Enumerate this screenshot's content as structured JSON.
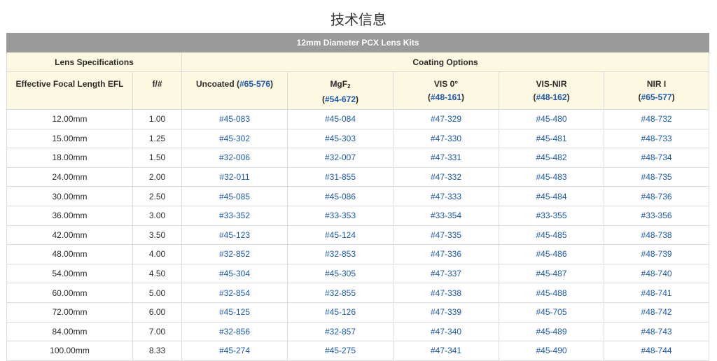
{
  "page": {
    "title": "技术信息"
  },
  "table": {
    "kit_title": "12mm Diameter PCX Lens Kits",
    "group_headers": {
      "specs": "Lens Specifications",
      "coatings": "Coating Options"
    },
    "columns": {
      "efl": "Effective Focal Length EFL",
      "fnum": "f/#",
      "uncoated": {
        "label": "Uncoated (",
        "code": "#65-576",
        "suffix": ")"
      },
      "mgf2": {
        "label": "MgF",
        "sub": "2",
        "code": "#54-672"
      },
      "vis0": {
        "label": "VIS 0°",
        "code": "#48-161"
      },
      "visnir": {
        "label": "VIS-NIR",
        "code": "#48-162"
      },
      "nir1": {
        "label": "NIR I",
        "code": "#65-577"
      }
    },
    "rows": [
      {
        "efl": "12.00mm",
        "fnum": "1.00",
        "uncoated": "#45-083",
        "mgf2": "#45-084",
        "vis0": "#47-329",
        "visnir": "#45-480",
        "nir1": "#48-732"
      },
      {
        "efl": "15.00mm",
        "fnum": "1.25",
        "uncoated": "#45-302",
        "mgf2": "#45-303",
        "vis0": "#47-330",
        "visnir": "#45-481",
        "nir1": "#48-733"
      },
      {
        "efl": "18.00mm",
        "fnum": "1.50",
        "uncoated": "#32-006",
        "mgf2": "#32-007",
        "vis0": "#47-331",
        "visnir": "#45-482",
        "nir1": "#48-734"
      },
      {
        "efl": "24.00mm",
        "fnum": "2.00",
        "uncoated": "#32-011",
        "mgf2": "#31-855",
        "vis0": "#47-332",
        "visnir": "#45-483",
        "nir1": "#48-735"
      },
      {
        "efl": "30.00mm",
        "fnum": "2.50",
        "uncoated": "#45-085",
        "mgf2": "#45-086",
        "vis0": "#47-333",
        "visnir": "#45-484",
        "nir1": "#48-736"
      },
      {
        "efl": "36.00mm",
        "fnum": "3.00",
        "uncoated": "#33-352",
        "mgf2": "#33-353",
        "vis0": "#33-354",
        "visnir": "#33-355",
        "nir1": "#33-356"
      },
      {
        "efl": "42.00mm",
        "fnum": "3.50",
        "uncoated": "#45-123",
        "mgf2": "#45-124",
        "vis0": "#47-335",
        "visnir": "#45-485",
        "nir1": "#48-738"
      },
      {
        "efl": "48.00mm",
        "fnum": "4.00",
        "uncoated": "#32-852",
        "mgf2": "#32-853",
        "vis0": "#47-336",
        "visnir": "#45-486",
        "nir1": "#48-739"
      },
      {
        "efl": "54.00mm",
        "fnum": "4.50",
        "uncoated": "#45-304",
        "mgf2": "#45-305",
        "vis0": "#47-337",
        "visnir": "#45-487",
        "nir1": "#48-740"
      },
      {
        "efl": "60.00mm",
        "fnum": "5.00",
        "uncoated": "#32-854",
        "mgf2": "#32-855",
        "vis0": "#47-338",
        "visnir": "#45-488",
        "nir1": "#48-741"
      },
      {
        "efl": "72.00mm",
        "fnum": "6.00",
        "uncoated": "#45-125",
        "mgf2": "#45-126",
        "vis0": "#47-339",
        "visnir": "#45-705",
        "nir1": "#48-742"
      },
      {
        "efl": "84.00mm",
        "fnum": "7.00",
        "uncoated": "#32-856",
        "mgf2": "#32-857",
        "vis0": "#47-340",
        "visnir": "#45-489",
        "nir1": "#48-743"
      },
      {
        "efl": "100.00mm",
        "fnum": "8.33",
        "uncoated": "#45-274",
        "mgf2": "#45-275",
        "vis0": "#47-341",
        "visnir": "#45-490",
        "nir1": "#48-744"
      }
    ]
  },
  "colors": {
    "link": "#1a59b3",
    "header_bg": "#fdf8e1",
    "kit_bar": "#9a9a9a",
    "border": "#dcdcdc"
  }
}
